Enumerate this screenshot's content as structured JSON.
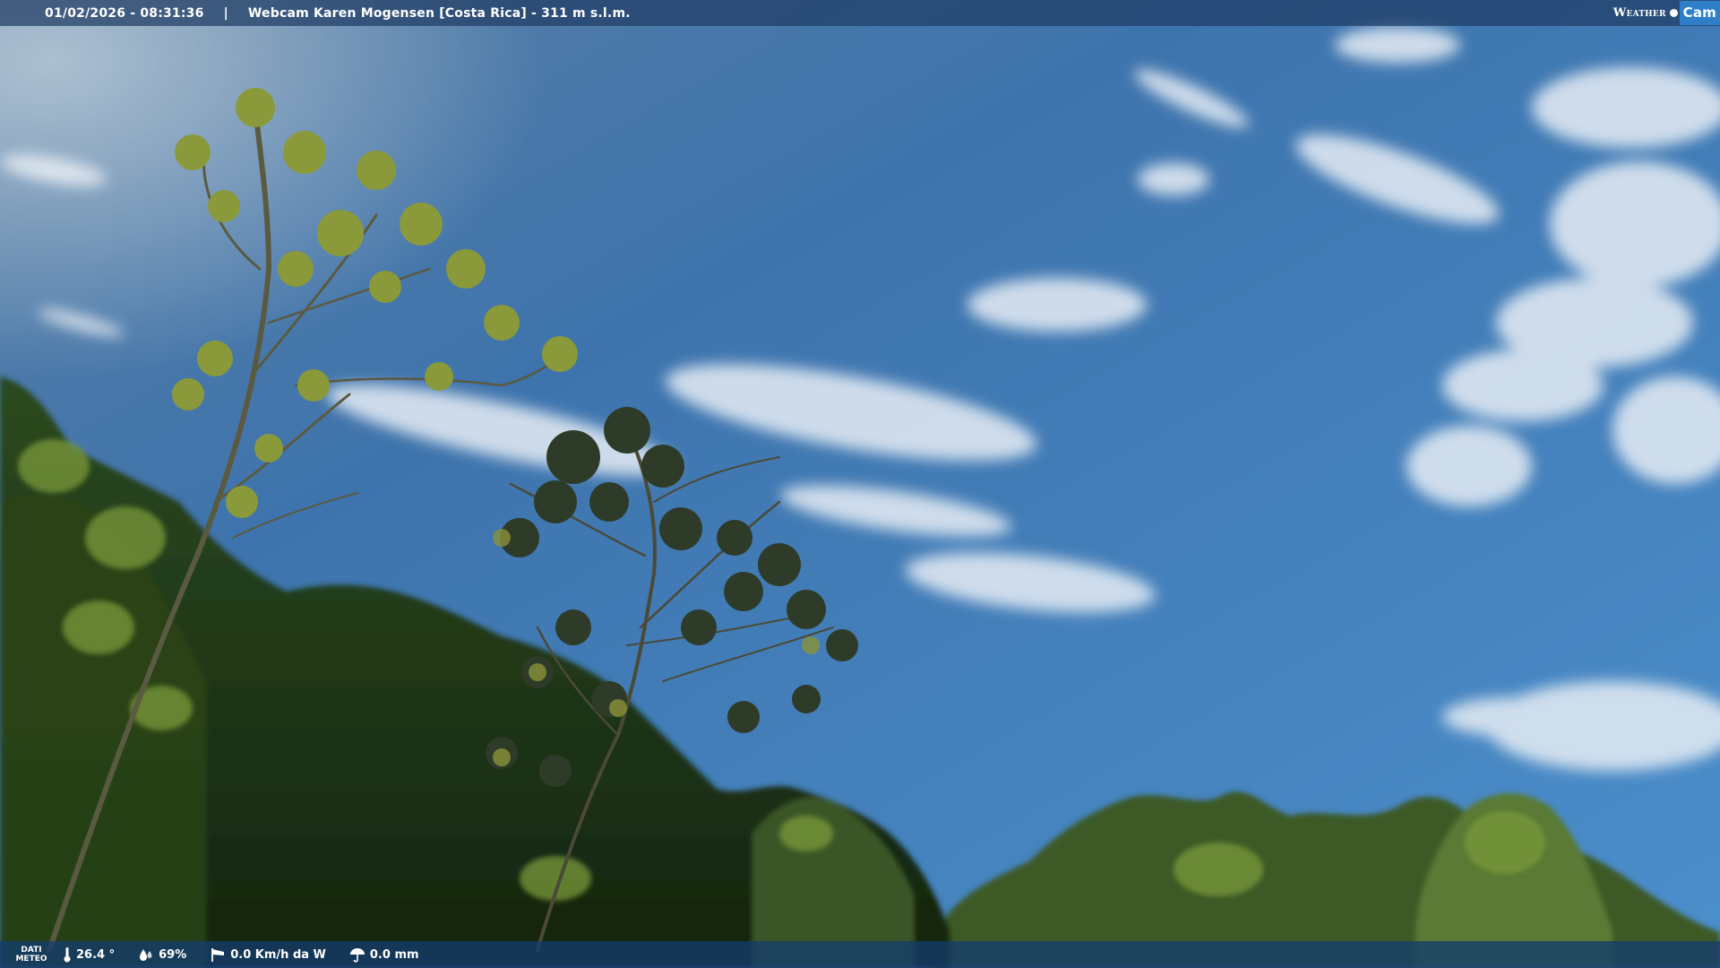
{
  "header": {
    "datetime": "01/02/2026 - 08:31:36",
    "separator": "|",
    "title": "Webcam Karen Mogensen [Costa Rica] - 311 m s.l.m.",
    "brand_word": "Weather",
    "brand_box": "Cam"
  },
  "footer": {
    "dati_line1": "DATI",
    "dati_line2": "METEO",
    "temperature": "26.4 °",
    "humidity": "69%",
    "wind": "0.0 Km/h da W",
    "rain": "0.0 mm"
  },
  "icons": {
    "temperature": "thermometer-icon",
    "humidity": "drop-icon",
    "wind": "windsock-icon",
    "rain": "umbrella-icon",
    "brand": "sun-dot-icon"
  },
  "colors": {
    "sky_top": "#3d6fa8",
    "sky_bottom": "#4a90cc",
    "foliage_dark": "#1e3a1a",
    "foliage_light": "#8aa840",
    "bar": "#1e3c64",
    "brand_box": "#2f7fc8"
  }
}
